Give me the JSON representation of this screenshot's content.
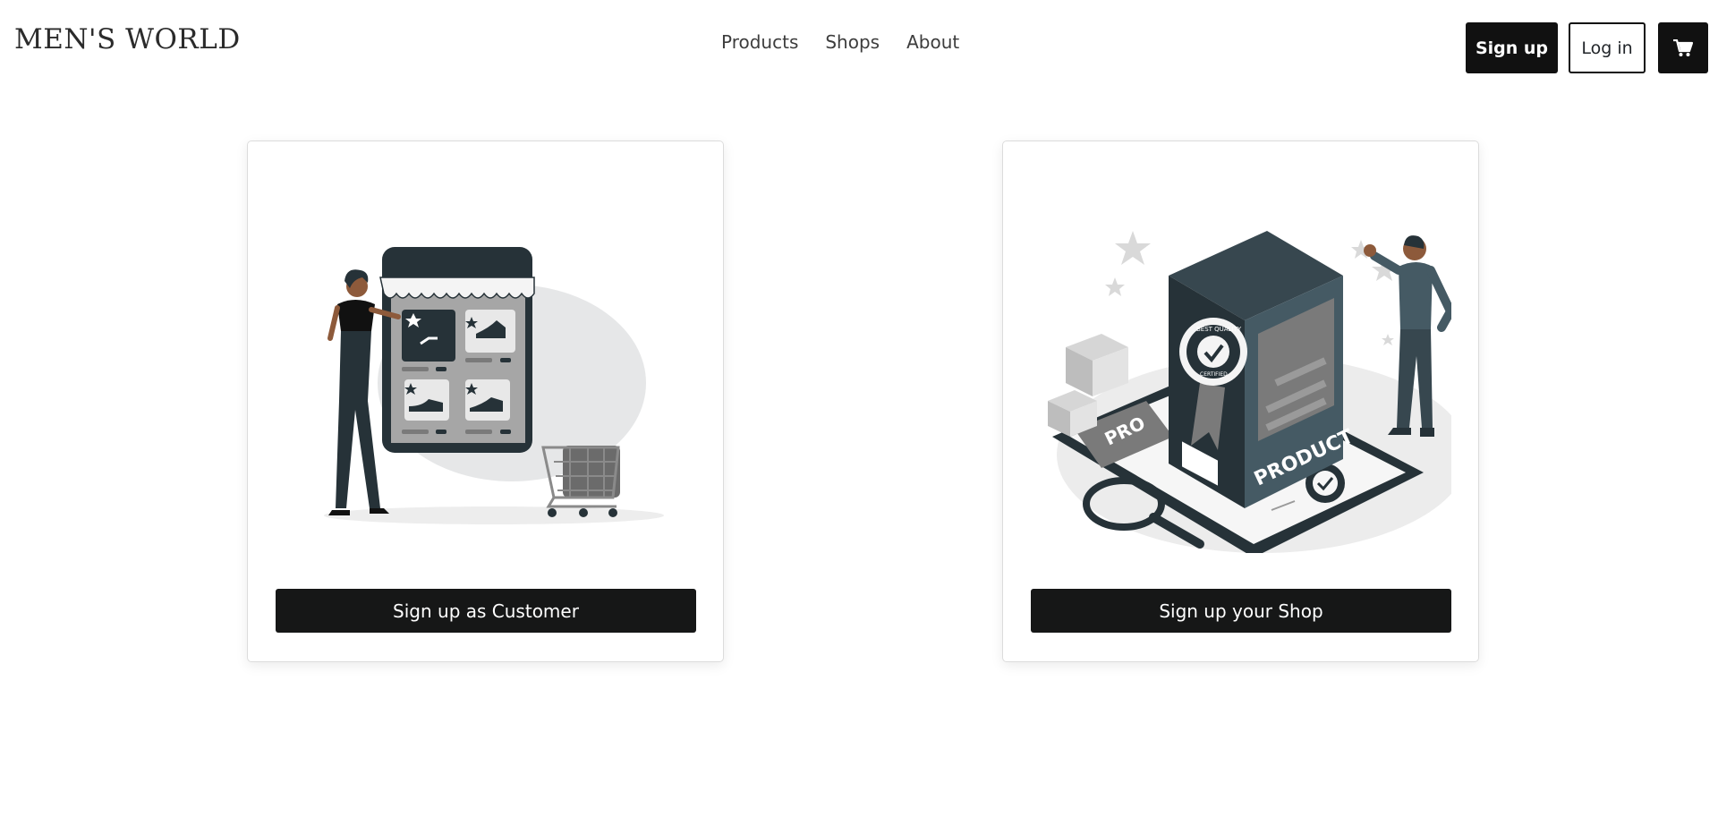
{
  "brand": {
    "name": "MEN'S WORLD"
  },
  "nav": {
    "links": [
      {
        "label": "Products"
      },
      {
        "label": "Shops"
      },
      {
        "label": "About"
      }
    ]
  },
  "auth": {
    "signup_label": "Sign up",
    "login_label": "Log in",
    "cart_icon": "shopping-cart-icon"
  },
  "cards": [
    {
      "button_label": "Sign up as Customer",
      "illustration": "online-shopping-illustration"
    },
    {
      "button_label": "Sign up your Shop",
      "illustration": "certified-product-illustration"
    }
  ],
  "illustration_text": {
    "box_label": "PRODUCT",
    "board_label": "PRO",
    "seal_top": "BEST QUALITY",
    "seal_bottom": "CERTIFIED"
  },
  "colors": {
    "primary": "#111111",
    "card_button": "#161717",
    "background": "#ffffff"
  }
}
